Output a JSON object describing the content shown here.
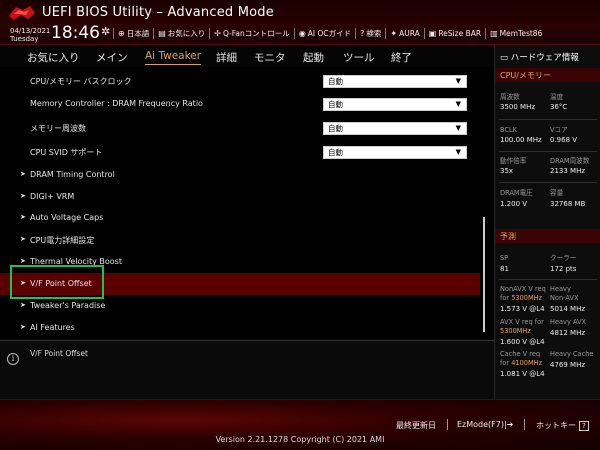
{
  "header": {
    "title": "UEFI BIOS Utility – Advanced Mode",
    "date": "04/13/2021",
    "day": "Tuesday",
    "time": "18:46",
    "tools": [
      {
        "icon": "globe-icon",
        "label": "日本語"
      },
      {
        "icon": "favorites-icon",
        "label": "お気に入り"
      },
      {
        "icon": "fan-icon",
        "label": "Q-Fanコントロール"
      },
      {
        "icon": "ai-oc-icon",
        "label": "AI OCガイド"
      },
      {
        "icon": "search-icon",
        "label": "検索"
      },
      {
        "icon": "aura-icon",
        "label": "AURA"
      },
      {
        "icon": "resize-bar-icon",
        "label": "ReSize BAR"
      },
      {
        "icon": "memtest-icon",
        "label": "MemTest86"
      }
    ]
  },
  "menu": {
    "items": [
      "お気に入り",
      "メイン",
      "Ai Tweaker",
      "詳細",
      "モニタ",
      "起動",
      "ツール",
      "終了"
    ],
    "active": "Ai Tweaker"
  },
  "settings": [
    {
      "label": "CPU/メモリー バスクロック",
      "value": "自動"
    },
    {
      "label": "Memory Controller : DRAM Frequency Ratio",
      "value": "自動"
    },
    {
      "label": "メモリー周波数",
      "value": "自動"
    },
    {
      "label": "CPU SVID サポート",
      "value": "自動"
    }
  ],
  "submenus": [
    "DRAM Timing Control",
    "DIGI+ VRM",
    "Auto Voltage Caps",
    "CPU電力詳細設定",
    "Thermal Velocity Boost",
    "V/F Point Offset",
    "Tweaker's Paradise",
    "AI Features"
  ],
  "selected_item": "V/F Point Offset",
  "help": {
    "text": "V/F Point Offset"
  },
  "hardware": {
    "title": "ハードウェア情報",
    "cpu_section": "CPU/メモリー",
    "cpu": [
      {
        "label": "周波数",
        "value": "3500 MHz"
      },
      {
        "label": "温度",
        "value": "36°C"
      },
      {
        "label": "BCLK",
        "value": "100.00 MHz"
      },
      {
        "label": "Vコア",
        "value": "0.968 V"
      },
      {
        "label": "動作倍率",
        "value": "35x"
      },
      {
        "label": "DRAM周波数",
        "value": "2133 MHz"
      },
      {
        "label": "DRAM電圧",
        "value": "1.200 V"
      },
      {
        "label": "容量",
        "value": "32768 MB"
      }
    ],
    "predict_section": "予測",
    "sp_label": "SP",
    "sp_value": "81",
    "cooler_label": "クーラー",
    "cooler_value": "172 pts",
    "nonavx_label": "NonAVX V req",
    "nonavx_for": "for",
    "nonavx_freq": "5300MHz",
    "nonavx_value": "1.573 V @L4",
    "heavy_nonavx_label1": "Heavy",
    "heavy_nonavx_label2": "Non-AVX",
    "heavy_nonavx_value": "5014 MHz",
    "avx_label": "AVX V req",
    "avx_for": "for",
    "avx_freq": "5300MHz",
    "avx_value": "1.600 V @L4",
    "heavy_avx_label": "Heavy AVX",
    "heavy_avx_value": "4812 MHz",
    "cache_label": "Cache V req",
    "cache_for": "for",
    "cache_freq": "4100MHz",
    "cache_value": "1.081 V @L4",
    "heavy_cache_label": "Heavy Cache",
    "heavy_cache_value": "4769 MHz"
  },
  "footer": {
    "last_modified": "最終更新日",
    "ezmode": "EzMode(F7)",
    "hotkey": "ホットキー",
    "hotkey_key": "?",
    "copyright": "Version 2.21.1278 Copyright (C) 2021 AMI"
  }
}
